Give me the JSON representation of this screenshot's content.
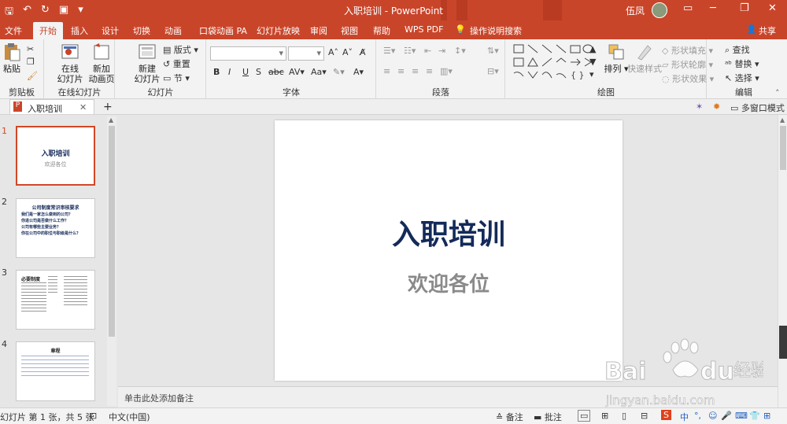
{
  "app": {
    "title": "入职培训 - PowerPoint",
    "user": "伍凤"
  },
  "tabs": [
    "文件",
    "开始",
    "插入",
    "设计",
    "切换",
    "动画",
    "口袋动画 PA",
    "幻灯片放映",
    "审阅",
    "视图",
    "帮助",
    "WPS PDF",
    "操作说明搜索",
    "共享"
  ],
  "ribbon": {
    "clipboard": {
      "paste": "粘贴",
      "label": "剪贴板"
    },
    "online": {
      "btn1a": "在线",
      "btn1b": "幻灯片",
      "btn2a": "新加",
      "btn2b": "动画页",
      "label": "在线幻灯片"
    },
    "slides": {
      "new_a": "新建",
      "new_b": "幻灯片",
      "layout": "版式",
      "reset": "重置",
      "section": "节",
      "label": "幻灯片"
    },
    "font": {
      "label": "字体",
      "b": "B",
      "i": "I",
      "u": "U",
      "s": "S"
    },
    "paragraph": {
      "label": "段落"
    },
    "drawing": {
      "arrange": "排列",
      "quick": "快速样式",
      "fill": "形状填充",
      "outline": "形状轮廓",
      "effect": "形状效果",
      "label": "绘图"
    },
    "editing": {
      "find": "查找",
      "replace": "替换",
      "select": "选择",
      "label": "编辑"
    }
  },
  "doc_tab": {
    "name": "入职培训",
    "multiwindow": "多窗口模式"
  },
  "thumbs": [
    {
      "n": "1",
      "title": "入职培训",
      "sub": "欢迎各位"
    },
    {
      "n": "2",
      "title": "公司制度常识审核要求",
      "lines": [
        "我们是一家怎么做到的公司？",
        "你进公司是否做什么工作？",
        "公司有哪些主要业务？",
        "你在公司中的职位与职级是什么？"
      ]
    },
    {
      "n": "3",
      "title": "必要制度"
    },
    {
      "n": "4",
      "title": "章程"
    }
  ],
  "slide": {
    "title": "入职培训",
    "subtitle": "欢迎各位"
  },
  "notes_placeholder": "单击此处添加备注",
  "status": {
    "slide_info": "幻灯片 第 1 张，共 5 张",
    "language": "中文(中国)",
    "notes": "备注",
    "comments": "批注",
    "ime": "中"
  },
  "colors": {
    "accent": "#c9452a",
    "slide_title": "#142a5a"
  }
}
